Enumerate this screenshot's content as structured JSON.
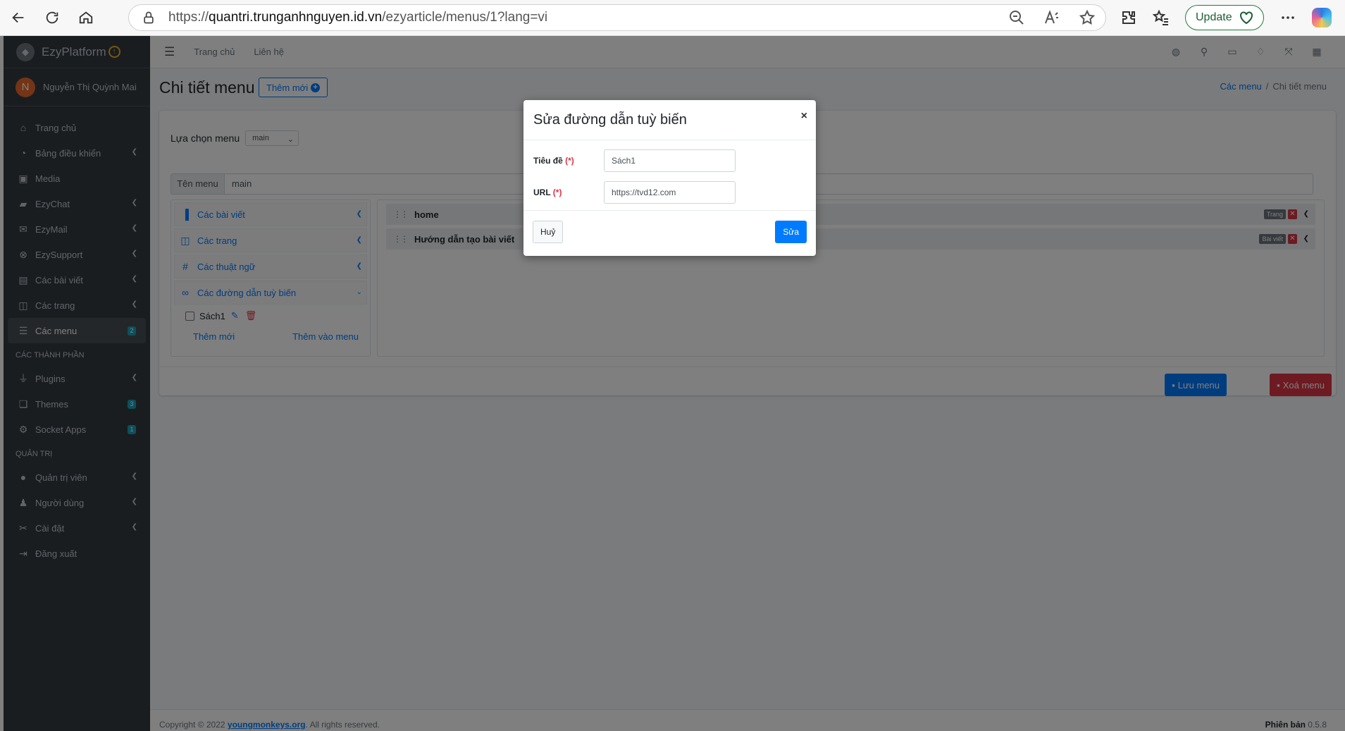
{
  "browser": {
    "url_host": "quantri.trunganhnguyen.id.vn",
    "url_path": "/ezyarticle/menus/1?lang=vi",
    "url_prefix": "https://",
    "update_label": "Update"
  },
  "sidebar": {
    "brand": "EzyPlatform",
    "user_initial": "N",
    "user_name": "Nguyễn Thị Quỳnh Mai",
    "items": [
      {
        "label": "Trang chủ",
        "icon": "home-icon"
      },
      {
        "label": "Bảng điều khiển",
        "icon": "dashboard-icon"
      },
      {
        "label": "Media",
        "icon": "image-icon"
      },
      {
        "label": "EzyChat",
        "icon": "chat-icon"
      },
      {
        "label": "EzyMail",
        "icon": "mail-icon"
      },
      {
        "label": "EzySupport",
        "icon": "support-icon"
      },
      {
        "label": "Các bài viết",
        "icon": "article-icon"
      },
      {
        "label": "Các trang",
        "icon": "page-icon"
      },
      {
        "label": "Các menu",
        "icon": "menu-icon",
        "badge": "2"
      }
    ],
    "section_components": "CÁC THÀNH PHẦN",
    "component_items": [
      {
        "label": "Plugins",
        "icon": "plug-icon"
      },
      {
        "label": "Themes",
        "icon": "theme-icon",
        "badge": "3"
      },
      {
        "label": "Socket Apps",
        "icon": "socket-icon",
        "badge": "1"
      }
    ],
    "section_admin": "QUẢN TRỊ",
    "admin_items": [
      {
        "label": "Quản trị viên",
        "icon": "admin-icon"
      },
      {
        "label": "Người dùng",
        "icon": "users-icon"
      },
      {
        "label": "Cài đặt",
        "icon": "settings-icon"
      },
      {
        "label": "Đăng xuất",
        "icon": "logout-icon"
      }
    ]
  },
  "topnav": {
    "links": [
      "Trang chủ",
      "Liên hệ"
    ]
  },
  "page": {
    "title": "Chi tiết menu",
    "add_new": "Thêm mới",
    "breadcrumb_link": "Các menu",
    "breadcrumb_current": "Chi tiết menu",
    "select_label": "Lựa chọn menu",
    "select_value": "main",
    "name_label": "Tên menu",
    "name_value": "main",
    "accordion": [
      {
        "label": "Các bài viết"
      },
      {
        "label": "Các trang"
      },
      {
        "label": "Các thuật ngữ"
      },
      {
        "label": "Các đường dẫn tuỳ biến"
      }
    ],
    "custom_link_item": "Sách1",
    "panel_add_new": "Thêm mới",
    "panel_add_to_menu": "Thêm vào menu",
    "menu_rows": [
      {
        "label": "home",
        "type": "Trang"
      },
      {
        "label": "Hướng dẫn tạo bài viết",
        "type": "Bài viết"
      }
    ],
    "save_menu": "Lưu menu",
    "delete_menu": "Xoá menu"
  },
  "footer": {
    "copyright_prefix": "Copyright © 2022",
    "copyright_link": "youngmonkeys.org",
    "copyright_suffix": ". All rights reserved.",
    "version_label": "Phiên bản",
    "version": "0.5.8"
  },
  "modal": {
    "title": "Sửa đường dẫn tuỳ biến",
    "close": "×",
    "title_label": "Tiêu đề",
    "title_value": "Sách1",
    "url_label": "URL",
    "url_value": "https://tvd12.com",
    "required_mark": "(*)",
    "cancel": "Huỷ",
    "submit": "Sửa"
  }
}
